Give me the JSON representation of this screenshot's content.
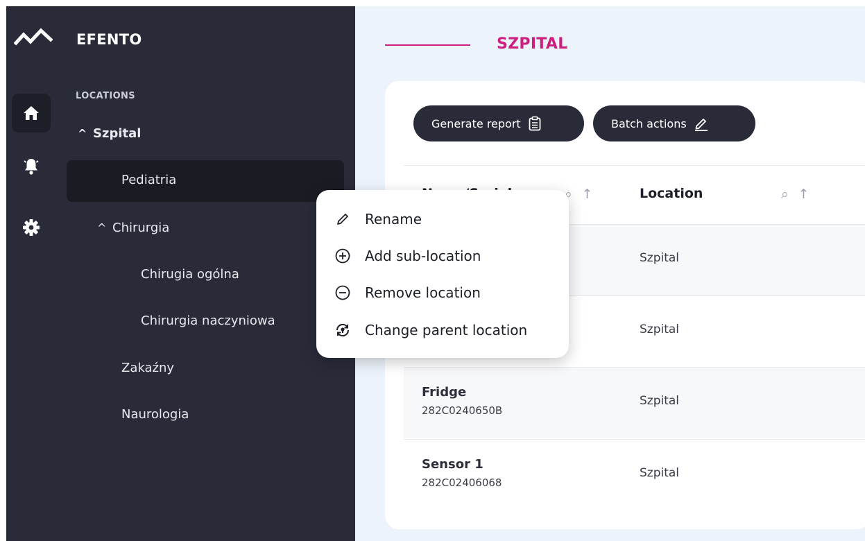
{
  "brand": {
    "name": "EFENTO"
  },
  "sidebar": {
    "heading": "LOCATIONS",
    "rail": [
      "home-icon",
      "bell-icon",
      "gear-icon"
    ],
    "tree": {
      "root": "Szpital",
      "pediatria": "Pediatria",
      "chirurgia": "Chirurgia",
      "chirugia_ogolna": "Chirugia ogólna",
      "chirurgia_naczyniowa": "Chirurgia naczyniowa",
      "zakazny": "Zakaźny",
      "naurologia": "Naurologia"
    }
  },
  "page": {
    "title": "SZPITAL"
  },
  "toolbar": {
    "generate_report": "Generate report",
    "batch_actions": "Batch actions"
  },
  "table": {
    "headers": {
      "name": "Name/Serial",
      "location": "Location"
    },
    "rows": [
      {
        "name": "",
        "serial": "",
        "location": "Szpital"
      },
      {
        "name": "",
        "serial": "",
        "location": "Szpital"
      },
      {
        "name": "Fridge",
        "serial": "282C0240650B",
        "location": "Szpital"
      },
      {
        "name": "Sensor 1",
        "serial": "282C02406068",
        "location": "Szpital"
      }
    ]
  },
  "context_menu": {
    "rename": "Rename",
    "add": "Add sub-location",
    "remove": "Remove location",
    "change_parent": "Change parent location"
  },
  "colors": {
    "accent": "#cc1f7f",
    "sidebar": "#292b39",
    "main_bg": "#edf3fb"
  }
}
